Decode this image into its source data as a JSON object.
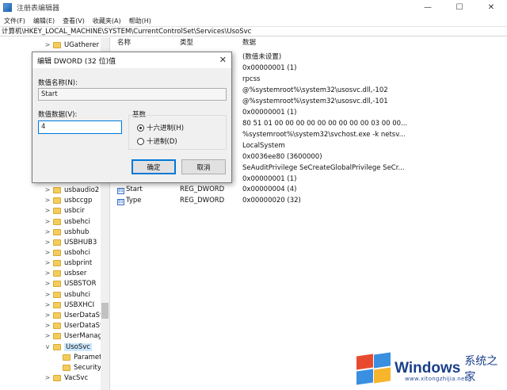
{
  "window": {
    "title": "注册表编辑器"
  },
  "menu": [
    "文件(F)",
    "编辑(E)",
    "查看(V)",
    "收藏夹(A)",
    "帮助(H)"
  ],
  "address": "计算机\\HKEY_LOCAL_MACHINE\\SYSTEM\\CurrentControlSet\\Services\\UsoSvc",
  "tree": [
    {
      "label": "UGatherer",
      "expander": ">"
    },
    {
      "label": "usbaudio2",
      "expander": ">"
    },
    {
      "label": "usbccgp",
      "expander": ">"
    },
    {
      "label": "usbcir",
      "expander": ">"
    },
    {
      "label": "usbehci",
      "expander": ">"
    },
    {
      "label": "usbhub",
      "expander": ">"
    },
    {
      "label": "USBHUB3",
      "expander": ">"
    },
    {
      "label": "usbohci",
      "expander": ">"
    },
    {
      "label": "usbprint",
      "expander": ">"
    },
    {
      "label": "usbser",
      "expander": ">"
    },
    {
      "label": "USBSTOR",
      "expander": ">"
    },
    {
      "label": "usbuhci",
      "expander": ">"
    },
    {
      "label": "USBXHCI",
      "expander": ">"
    },
    {
      "label": "UserDataSvc",
      "expander": ">"
    },
    {
      "label": "UserDataSvc",
      "expander": ">"
    },
    {
      "label": "UserManage",
      "expander": ">"
    },
    {
      "label": "UsoSvc",
      "expander": "v"
    },
    {
      "label": "Parameter",
      "expander": ""
    },
    {
      "label": "Security",
      "expander": ""
    },
    {
      "label": "VacSvc",
      "expander": ">"
    }
  ],
  "columns": {
    "name": "名称",
    "type": "类型",
    "data": "数据"
  },
  "values": [
    {
      "name": "",
      "type": "",
      "data": "(数值未设置)"
    },
    {
      "name": "",
      "type": "",
      "data": "0x00000001 (1)"
    },
    {
      "name": "",
      "type": "",
      "data": "rpcss"
    },
    {
      "name": "",
      "type": "",
      "data": "@%systemroot%\\system32\\usosvc.dll,-102"
    },
    {
      "name": "",
      "type": "",
      "data": "@%systemroot%\\system32\\usosvc.dll,-101"
    },
    {
      "name": "",
      "type": "",
      "data": "0x00000001 (1)"
    },
    {
      "name": "",
      "type": "",
      "data": "80 51 01 00 00 00 00 00 00 00 00 00 03 00 00..."
    },
    {
      "name": "",
      "type": "",
      "data": "%systemroot%\\system32\\svchost.exe -k netsv..."
    },
    {
      "name": "",
      "type": "",
      "data": "LocalSystem"
    },
    {
      "name": "",
      "type": "",
      "data": "0x0036ee80 (3600000)"
    },
    {
      "name": "",
      "type": "",
      "data": "SeAuditPrivilege SeCreateGlobalPrivilege SeCr..."
    },
    {
      "name": "",
      "type": "",
      "data": "0x00000001 (1)"
    },
    {
      "name": "Start",
      "type": "REG_DWORD",
      "data": "0x00000004 (4)"
    },
    {
      "name": "Type",
      "type": "REG_DWORD",
      "data": "0x00000020 (32)"
    }
  ],
  "dialog": {
    "title": "编辑 DWORD (32 位)值",
    "name_label": "数值名称(N):",
    "name_value": "Start",
    "data_label": "数值数据(V):",
    "data_value": "4",
    "base_label": "基数",
    "hex_label": "十六进制(H)",
    "dec_label": "十进制(D)",
    "ok_label": "确定",
    "cancel_label": "取消"
  },
  "watermark": {
    "brand": "Windows",
    "sub": "系统之家",
    "url": "www.xitongzhijia.net"
  }
}
